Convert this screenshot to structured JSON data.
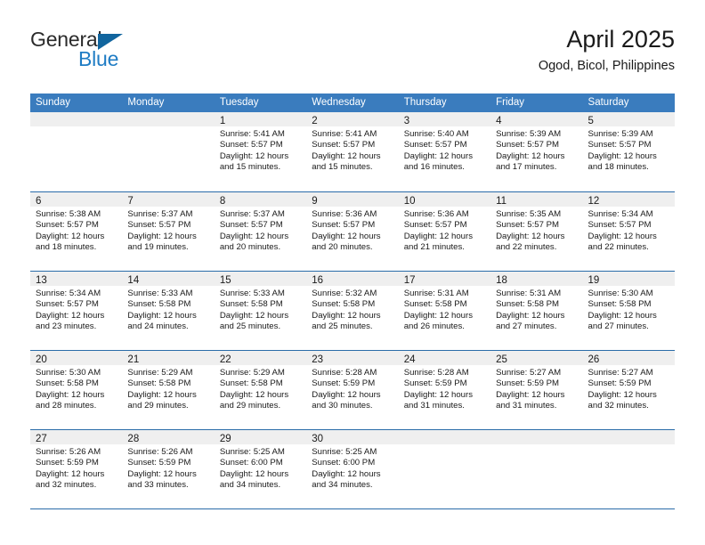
{
  "brand": {
    "name_part1": "General",
    "name_part2": "Blue",
    "triangle_color": "#11659e",
    "blue_color": "#1f7cc4"
  },
  "header": {
    "title": "April 2025",
    "subtitle": "Ogod, Bicol, Philippines"
  },
  "theme": {
    "header_row_bg": "#3a7cbe",
    "row_divider": "#2a6ca9",
    "day_band_bg": "#efefef"
  },
  "weekdays": [
    "Sunday",
    "Monday",
    "Tuesday",
    "Wednesday",
    "Thursday",
    "Friday",
    "Saturday"
  ],
  "weeks": [
    [
      {
        "day": "",
        "sunrise": "",
        "sunset": "",
        "daylight": "",
        "daylight2": ""
      },
      {
        "day": "",
        "sunrise": "",
        "sunset": "",
        "daylight": "",
        "daylight2": ""
      },
      {
        "day": "1",
        "sunrise": "Sunrise: 5:41 AM",
        "sunset": "Sunset: 5:57 PM",
        "daylight": "Daylight: 12 hours",
        "daylight2": "and 15 minutes."
      },
      {
        "day": "2",
        "sunrise": "Sunrise: 5:41 AM",
        "sunset": "Sunset: 5:57 PM",
        "daylight": "Daylight: 12 hours",
        "daylight2": "and 15 minutes."
      },
      {
        "day": "3",
        "sunrise": "Sunrise: 5:40 AM",
        "sunset": "Sunset: 5:57 PM",
        "daylight": "Daylight: 12 hours",
        "daylight2": "and 16 minutes."
      },
      {
        "day": "4",
        "sunrise": "Sunrise: 5:39 AM",
        "sunset": "Sunset: 5:57 PM",
        "daylight": "Daylight: 12 hours",
        "daylight2": "and 17 minutes."
      },
      {
        "day": "5",
        "sunrise": "Sunrise: 5:39 AM",
        "sunset": "Sunset: 5:57 PM",
        "daylight": "Daylight: 12 hours",
        "daylight2": "and 18 minutes."
      }
    ],
    [
      {
        "day": "6",
        "sunrise": "Sunrise: 5:38 AM",
        "sunset": "Sunset: 5:57 PM",
        "daylight": "Daylight: 12 hours",
        "daylight2": "and 18 minutes."
      },
      {
        "day": "7",
        "sunrise": "Sunrise: 5:37 AM",
        "sunset": "Sunset: 5:57 PM",
        "daylight": "Daylight: 12 hours",
        "daylight2": "and 19 minutes."
      },
      {
        "day": "8",
        "sunrise": "Sunrise: 5:37 AM",
        "sunset": "Sunset: 5:57 PM",
        "daylight": "Daylight: 12 hours",
        "daylight2": "and 20 minutes."
      },
      {
        "day": "9",
        "sunrise": "Sunrise: 5:36 AM",
        "sunset": "Sunset: 5:57 PM",
        "daylight": "Daylight: 12 hours",
        "daylight2": "and 20 minutes."
      },
      {
        "day": "10",
        "sunrise": "Sunrise: 5:36 AM",
        "sunset": "Sunset: 5:57 PM",
        "daylight": "Daylight: 12 hours",
        "daylight2": "and 21 minutes."
      },
      {
        "day": "11",
        "sunrise": "Sunrise: 5:35 AM",
        "sunset": "Sunset: 5:57 PM",
        "daylight": "Daylight: 12 hours",
        "daylight2": "and 22 minutes."
      },
      {
        "day": "12",
        "sunrise": "Sunrise: 5:34 AM",
        "sunset": "Sunset: 5:57 PM",
        "daylight": "Daylight: 12 hours",
        "daylight2": "and 22 minutes."
      }
    ],
    [
      {
        "day": "13",
        "sunrise": "Sunrise: 5:34 AM",
        "sunset": "Sunset: 5:57 PM",
        "daylight": "Daylight: 12 hours",
        "daylight2": "and 23 minutes."
      },
      {
        "day": "14",
        "sunrise": "Sunrise: 5:33 AM",
        "sunset": "Sunset: 5:58 PM",
        "daylight": "Daylight: 12 hours",
        "daylight2": "and 24 minutes."
      },
      {
        "day": "15",
        "sunrise": "Sunrise: 5:33 AM",
        "sunset": "Sunset: 5:58 PM",
        "daylight": "Daylight: 12 hours",
        "daylight2": "and 25 minutes."
      },
      {
        "day": "16",
        "sunrise": "Sunrise: 5:32 AM",
        "sunset": "Sunset: 5:58 PM",
        "daylight": "Daylight: 12 hours",
        "daylight2": "and 25 minutes."
      },
      {
        "day": "17",
        "sunrise": "Sunrise: 5:31 AM",
        "sunset": "Sunset: 5:58 PM",
        "daylight": "Daylight: 12 hours",
        "daylight2": "and 26 minutes."
      },
      {
        "day": "18",
        "sunrise": "Sunrise: 5:31 AM",
        "sunset": "Sunset: 5:58 PM",
        "daylight": "Daylight: 12 hours",
        "daylight2": "and 27 minutes."
      },
      {
        "day": "19",
        "sunrise": "Sunrise: 5:30 AM",
        "sunset": "Sunset: 5:58 PM",
        "daylight": "Daylight: 12 hours",
        "daylight2": "and 27 minutes."
      }
    ],
    [
      {
        "day": "20",
        "sunrise": "Sunrise: 5:30 AM",
        "sunset": "Sunset: 5:58 PM",
        "daylight": "Daylight: 12 hours",
        "daylight2": "and 28 minutes."
      },
      {
        "day": "21",
        "sunrise": "Sunrise: 5:29 AM",
        "sunset": "Sunset: 5:58 PM",
        "daylight": "Daylight: 12 hours",
        "daylight2": "and 29 minutes."
      },
      {
        "day": "22",
        "sunrise": "Sunrise: 5:29 AM",
        "sunset": "Sunset: 5:58 PM",
        "daylight": "Daylight: 12 hours",
        "daylight2": "and 29 minutes."
      },
      {
        "day": "23",
        "sunrise": "Sunrise: 5:28 AM",
        "sunset": "Sunset: 5:59 PM",
        "daylight": "Daylight: 12 hours",
        "daylight2": "and 30 minutes."
      },
      {
        "day": "24",
        "sunrise": "Sunrise: 5:28 AM",
        "sunset": "Sunset: 5:59 PM",
        "daylight": "Daylight: 12 hours",
        "daylight2": "and 31 minutes."
      },
      {
        "day": "25",
        "sunrise": "Sunrise: 5:27 AM",
        "sunset": "Sunset: 5:59 PM",
        "daylight": "Daylight: 12 hours",
        "daylight2": "and 31 minutes."
      },
      {
        "day": "26",
        "sunrise": "Sunrise: 5:27 AM",
        "sunset": "Sunset: 5:59 PM",
        "daylight": "Daylight: 12 hours",
        "daylight2": "and 32 minutes."
      }
    ],
    [
      {
        "day": "27",
        "sunrise": "Sunrise: 5:26 AM",
        "sunset": "Sunset: 5:59 PM",
        "daylight": "Daylight: 12 hours",
        "daylight2": "and 32 minutes."
      },
      {
        "day": "28",
        "sunrise": "Sunrise: 5:26 AM",
        "sunset": "Sunset: 5:59 PM",
        "daylight": "Daylight: 12 hours",
        "daylight2": "and 33 minutes."
      },
      {
        "day": "29",
        "sunrise": "Sunrise: 5:25 AM",
        "sunset": "Sunset: 6:00 PM",
        "daylight": "Daylight: 12 hours",
        "daylight2": "and 34 minutes."
      },
      {
        "day": "30",
        "sunrise": "Sunrise: 5:25 AM",
        "sunset": "Sunset: 6:00 PM",
        "daylight": "Daylight: 12 hours",
        "daylight2": "and 34 minutes."
      },
      {
        "day": "",
        "sunrise": "",
        "sunset": "",
        "daylight": "",
        "daylight2": ""
      },
      {
        "day": "",
        "sunrise": "",
        "sunset": "",
        "daylight": "",
        "daylight2": ""
      },
      {
        "day": "",
        "sunrise": "",
        "sunset": "",
        "daylight": "",
        "daylight2": ""
      }
    ]
  ]
}
